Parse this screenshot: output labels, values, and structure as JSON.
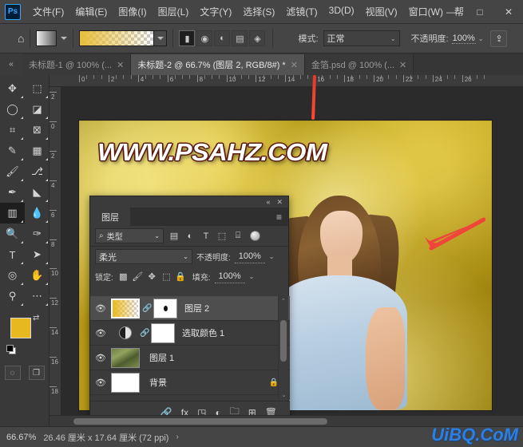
{
  "app": {
    "logo_text": "Ps",
    "menu_items": [
      {
        "label": "文件(F)",
        "name": "menu-file"
      },
      {
        "label": "编辑(E)",
        "name": "menu-edit"
      },
      {
        "label": "图像(I)",
        "name": "menu-image"
      },
      {
        "label": "图层(L)",
        "name": "menu-layer"
      },
      {
        "label": "文字(Y)",
        "name": "menu-type"
      },
      {
        "label": "选择(S)",
        "name": "menu-select"
      },
      {
        "label": "滤镜(T)",
        "name": "menu-filter"
      },
      {
        "label": "3D(D)",
        "name": "menu-3d"
      },
      {
        "label": "视图(V)",
        "name": "menu-view"
      },
      {
        "label": "窗口(W)",
        "name": "menu-window"
      },
      {
        "label": "帮",
        "name": "menu-help"
      }
    ],
    "window_controls": {
      "minimize": "—",
      "maximize": "□",
      "close": "✕"
    }
  },
  "options_bar": {
    "home_icon": "⌂",
    "preset_dropdown_caret": "⌄",
    "gradient_caret": "⌄",
    "gradient_types": [
      {
        "name": "gradient-linear",
        "glyph": "▮"
      },
      {
        "name": "gradient-radial",
        "glyph": "◉"
      },
      {
        "name": "gradient-angle",
        "glyph": "◐"
      },
      {
        "name": "gradient-reflected",
        "glyph": "▤"
      },
      {
        "name": "gradient-diamond",
        "glyph": "◈"
      }
    ],
    "mode_label": "模式:",
    "mode_value": "正常",
    "opacity_label": "不透明度:",
    "opacity_value": "100%",
    "opacity_caret": "⌄",
    "share_icon": "⇪",
    "gradient_color": "#e9be3b"
  },
  "tabs": {
    "collapse_icon": "«",
    "items": [
      {
        "label": "未标题-1 @ 100% (...",
        "active": false,
        "close": "✕"
      },
      {
        "label": "未标题-2 @ 66.7% (图层 2, RGB/8#) *",
        "active": true,
        "close": "✕"
      },
      {
        "label": "金箔.psd @ 100% (...",
        "active": false,
        "close": "✕"
      }
    ]
  },
  "toolbar": {
    "tools": [
      {
        "name": "move-tool",
        "glyph": "✥",
        "selected": false
      },
      {
        "name": "marquee-tool",
        "glyph": "⬚",
        "selected": false
      },
      {
        "name": "lasso-tool",
        "glyph": "◯",
        "selected": false
      },
      {
        "name": "quick-select-tool",
        "glyph": "◪",
        "selected": false
      },
      {
        "name": "crop-tool",
        "glyph": "⌗",
        "selected": false
      },
      {
        "name": "frame-tool",
        "glyph": "⊠",
        "selected": false
      },
      {
        "name": "eyedropper-tool",
        "glyph": "✎",
        "selected": false
      },
      {
        "name": "spot-healing-tool",
        "glyph": "▦",
        "selected": false
      },
      {
        "name": "brush-tool",
        "glyph": "🖌",
        "selected": false
      },
      {
        "name": "clone-stamp-tool",
        "glyph": "⎇",
        "selected": false
      },
      {
        "name": "history-brush-tool",
        "glyph": "✒",
        "selected": false
      },
      {
        "name": "eraser-tool",
        "glyph": "◣",
        "selected": false
      },
      {
        "name": "gradient-tool",
        "glyph": "▥",
        "selected": true
      },
      {
        "name": "blur-tool",
        "glyph": "💧",
        "selected": false
      },
      {
        "name": "dodge-tool",
        "glyph": "🔍",
        "selected": false
      },
      {
        "name": "pen-tool",
        "glyph": "✑",
        "selected": false
      },
      {
        "name": "type-tool",
        "glyph": "T",
        "selected": false
      },
      {
        "name": "path-select-tool",
        "glyph": "➤",
        "selected": false
      },
      {
        "name": "shape-tool",
        "glyph": "◎",
        "selected": false
      },
      {
        "name": "hand-tool",
        "glyph": "✋",
        "selected": false
      },
      {
        "name": "zoom-tool",
        "glyph": "⚲",
        "selected": false
      },
      {
        "name": "more-tools",
        "glyph": "⋯",
        "selected": false
      }
    ],
    "foreground_color": "#e8b91e",
    "background_color": "#ffffff",
    "swap_icon": "⇄",
    "quickmask_icon": "◌",
    "screenmode_icon": "❐"
  },
  "canvas": {
    "ruler_h_labels": [
      "0",
      "2",
      "4",
      "6",
      "8",
      "10",
      "12",
      "14",
      "16",
      "18",
      "20",
      "22",
      "24",
      "26"
    ],
    "ruler_v_labels": [
      "2",
      "0",
      "2",
      "4",
      "6",
      "8",
      "10",
      "12",
      "14",
      "16",
      "18"
    ],
    "artwork_text": "WWW.PSAHZ.COM"
  },
  "layers_panel": {
    "collapse_icon": "«",
    "close_icon": "✕",
    "tab_label": "图层",
    "menu_icon": "≡",
    "filter": {
      "search_icon": "⌕",
      "type_label": "类型",
      "caret": "⌄",
      "icons": [
        {
          "name": "filter-pixel-icon",
          "glyph": "▤"
        },
        {
          "name": "filter-adjustment-icon",
          "glyph": "◐"
        },
        {
          "name": "filter-type-icon",
          "glyph": "T"
        },
        {
          "name": "filter-shape-icon",
          "glyph": "⬚"
        },
        {
          "name": "filter-smart-object-icon",
          "glyph": "⌸"
        }
      ],
      "toggle_name": "filter-enable-toggle"
    },
    "blend_mode": "柔光",
    "blend_caret": "⌄",
    "opacity_label": "不透明度:",
    "opacity_value": "100%",
    "opacity_caret": "⌄",
    "lock_label": "锁定:",
    "lock_icons": [
      {
        "name": "lock-transparent-icon",
        "glyph": "▩"
      },
      {
        "name": "lock-image-icon",
        "glyph": "🖌"
      },
      {
        "name": "lock-position-icon",
        "glyph": "✥"
      },
      {
        "name": "lock-artboard-icon",
        "glyph": "⬚"
      },
      {
        "name": "lock-all-icon",
        "glyph": "🔒"
      }
    ],
    "fill_label": "填充:",
    "fill_value": "100%",
    "fill_caret": "⌄",
    "eye_icon": "👁",
    "link_icon": "🔗",
    "layers": [
      {
        "name": "图层 2",
        "thumb_type": "gradient",
        "has_mask": true,
        "selected": true,
        "locked": false
      },
      {
        "name": "选取颜色 1",
        "thumb_type": "adjustment",
        "has_mask": true,
        "selected": false,
        "locked": false
      },
      {
        "name": "图层 1",
        "thumb_type": "photo",
        "has_mask": false,
        "selected": false,
        "locked": false
      },
      {
        "name": "背景",
        "thumb_type": "white",
        "has_mask": false,
        "selected": false,
        "locked": true,
        "lock_glyph": "🔒"
      }
    ],
    "footer_buttons": [
      {
        "name": "link-layers-button",
        "glyph": "🔗"
      },
      {
        "name": "layer-style-button",
        "glyph": "fx"
      },
      {
        "name": "add-mask-button",
        "glyph": "◳"
      },
      {
        "name": "adjustment-layer-button",
        "glyph": "◐"
      },
      {
        "name": "new-group-button",
        "glyph": "🗀"
      },
      {
        "name": "new-layer-button",
        "glyph": "⊞"
      },
      {
        "name": "delete-layer-button",
        "glyph": "🗑"
      }
    ],
    "scroll_up": "⌃",
    "scroll_down": "⌄"
  },
  "status_bar": {
    "zoom": "66.67%",
    "dimensions": "26.46 厘米 x 17.64 厘米 (72 ppi)",
    "expand_arrow": "›"
  },
  "watermark": "UiBQ.CoM"
}
